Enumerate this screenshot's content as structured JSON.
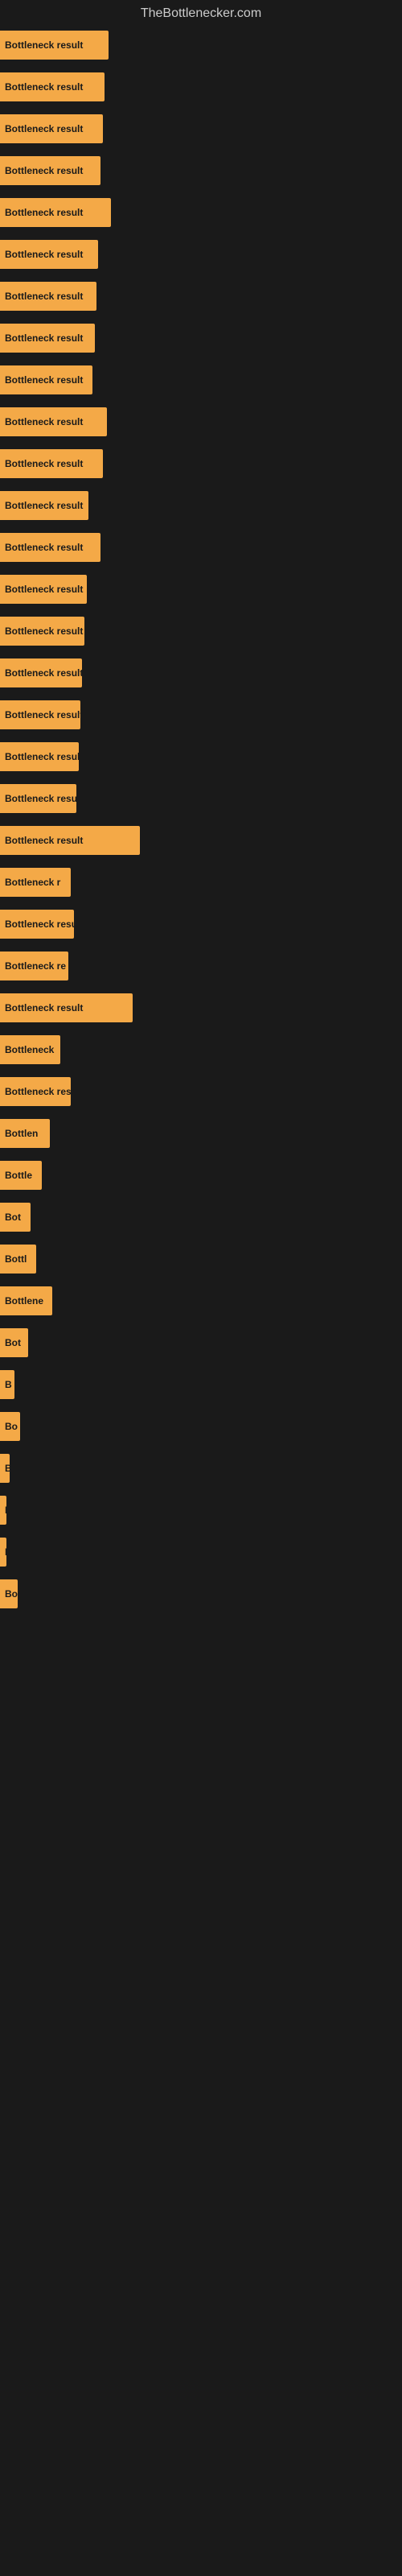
{
  "site": {
    "title": "TheBottlenecker.com"
  },
  "bars": [
    {
      "label": "Bottleneck result",
      "width": 135
    },
    {
      "label": "Bottleneck result",
      "width": 130
    },
    {
      "label": "Bottleneck result",
      "width": 128
    },
    {
      "label": "Bottleneck result",
      "width": 125
    },
    {
      "label": "Bottleneck result",
      "width": 138
    },
    {
      "label": "Bottleneck result",
      "width": 122
    },
    {
      "label": "Bottleneck result",
      "width": 120
    },
    {
      "label": "Bottleneck result",
      "width": 118
    },
    {
      "label": "Bottleneck result",
      "width": 115
    },
    {
      "label": "Bottleneck result",
      "width": 133
    },
    {
      "label": "Bottleneck result",
      "width": 128
    },
    {
      "label": "Bottleneck result",
      "width": 110
    },
    {
      "label": "Bottleneck result",
      "width": 125
    },
    {
      "label": "Bottleneck result",
      "width": 108
    },
    {
      "label": "Bottleneck result",
      "width": 105
    },
    {
      "label": "Bottleneck result",
      "width": 102
    },
    {
      "label": "Bottleneck result",
      "width": 100
    },
    {
      "label": "Bottleneck result",
      "width": 98
    },
    {
      "label": "Bottleneck resu",
      "width": 95
    },
    {
      "label": "Bottleneck result",
      "width": 174
    },
    {
      "label": "Bottleneck r",
      "width": 88
    },
    {
      "label": "Bottleneck resu",
      "width": 92
    },
    {
      "label": "Bottleneck re",
      "width": 85
    },
    {
      "label": "Bottleneck result",
      "width": 165
    },
    {
      "label": "Bottleneck",
      "width": 75
    },
    {
      "label": "Bottleneck resu",
      "width": 88
    },
    {
      "label": "Bottlen",
      "width": 62
    },
    {
      "label": "Bottle",
      "width": 52
    },
    {
      "label": "Bot",
      "width": 38
    },
    {
      "label": "Bottl",
      "width": 45
    },
    {
      "label": "Bottlene",
      "width": 65
    },
    {
      "label": "Bot",
      "width": 35
    },
    {
      "label": "B",
      "width": 18
    },
    {
      "label": "Bo",
      "width": 25
    },
    {
      "label": "B",
      "width": 12
    },
    {
      "label": "I",
      "width": 8
    },
    {
      "label": "I",
      "width": 8
    },
    {
      "label": "Bo",
      "width": 22
    }
  ]
}
